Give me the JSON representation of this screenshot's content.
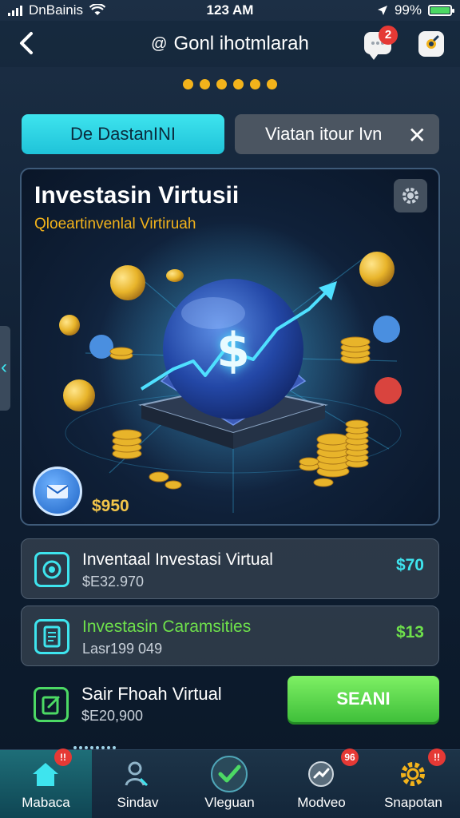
{
  "status_bar": {
    "carrier": "DnBainis",
    "time": "123 AM",
    "battery": "99%",
    "battery_level": 0.99
  },
  "header": {
    "back_icon": "chevron-left-icon",
    "title": "Gonl ihotmlarah",
    "title_glyph": "@",
    "chat_badge": "2"
  },
  "carousel": {
    "dot_count": 6,
    "color": "#f3b31b"
  },
  "tabs": {
    "active_label": "De DastanINI",
    "inactive_label": "Viatan itour Ivn"
  },
  "hero": {
    "title": "Investasin Virtusii",
    "subtitle": "Qloeartinvenlal Virtiruah",
    "amount": "$950",
    "dollar_sign": "$"
  },
  "cards": [
    {
      "title": "Inventaal Investasi Virtual",
      "sub": "$E32.970",
      "value": "$70"
    },
    {
      "title": "Investasin Caramsities",
      "sub": "Lasr199 049",
      "value": "$13"
    }
  ],
  "row3": {
    "title": "Sair Fhoah Virtual",
    "sub": "$E20,900",
    "cta": "SEANI"
  },
  "nav": [
    {
      "label": "Mabaca",
      "badge": "!!",
      "icon": "home-icon"
    },
    {
      "label": "Sindav",
      "badge": "",
      "icon": "people-icon"
    },
    {
      "label": "Vleguan",
      "badge": "",
      "icon": "shield-check-icon"
    },
    {
      "label": "Modveo",
      "badge": "96",
      "icon": "chart-icon"
    },
    {
      "label": "Snapotan",
      "badge": "!!",
      "icon": "gear-icon"
    }
  ],
  "colors": {
    "accent": "#3ee4ee",
    "gold": "#f3b31b",
    "green": "#4cd964",
    "badge_red": "#e53935"
  }
}
